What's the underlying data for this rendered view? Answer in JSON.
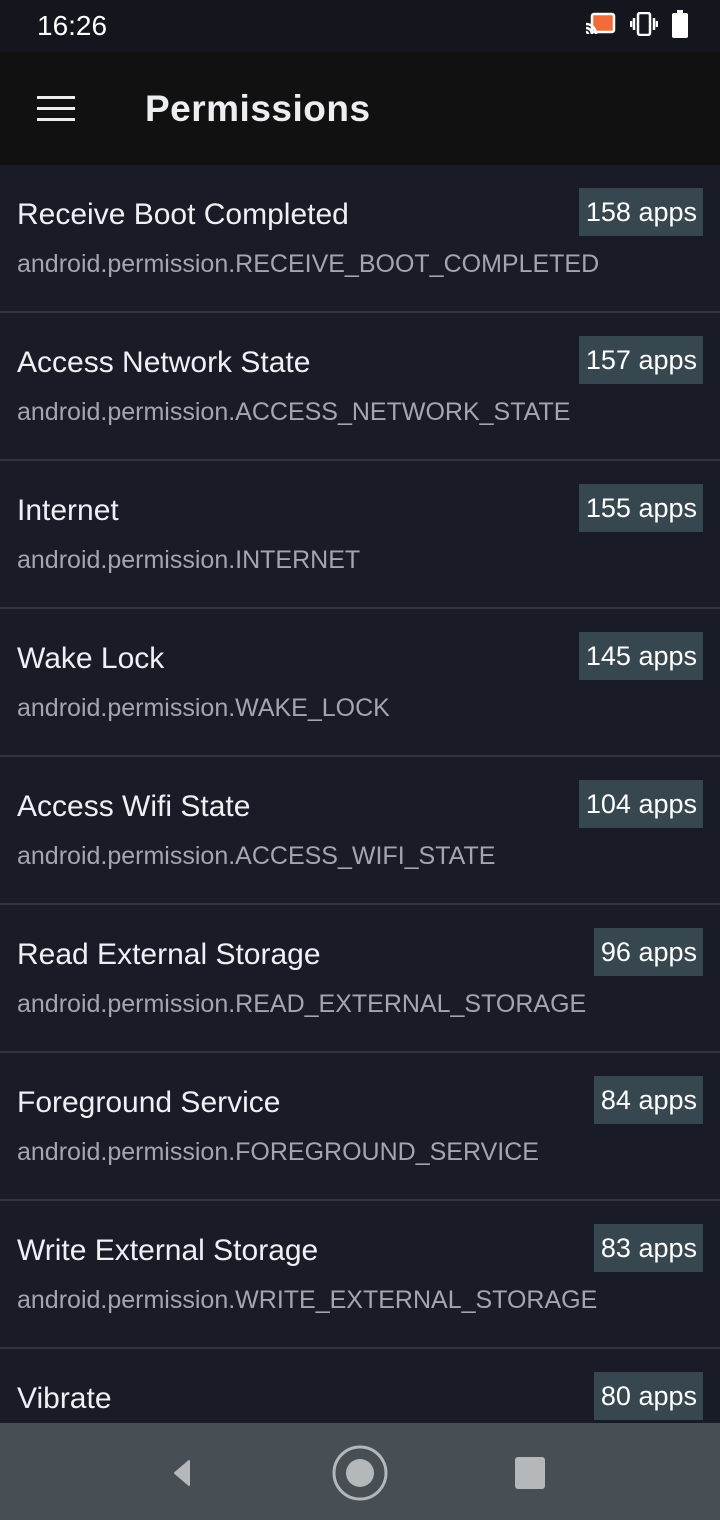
{
  "status_bar": {
    "time": "16:26",
    "icons": [
      "cast-icon",
      "vibrate-icon",
      "battery-icon"
    ],
    "cast_color": "#f26b3a"
  },
  "app_bar": {
    "title": "Permissions",
    "menu_icon": "hamburger-menu-icon"
  },
  "colors": {
    "background": "#191c26",
    "badge": "#37474f",
    "app_bar": "#111111",
    "nav_bar": "#474f55"
  },
  "permissions": [
    {
      "name": "Receive Boot Completed",
      "id": "android.permission.RECEIVE_BOOT_COMPLETED",
      "count": "158 apps"
    },
    {
      "name": "Access Network State",
      "id": "android.permission.ACCESS_NETWORK_STATE",
      "count": "157 apps"
    },
    {
      "name": "Internet",
      "id": "android.permission.INTERNET",
      "count": "155 apps"
    },
    {
      "name": "Wake Lock",
      "id": "android.permission.WAKE_LOCK",
      "count": "145 apps"
    },
    {
      "name": "Access Wifi State",
      "id": "android.permission.ACCESS_WIFI_STATE",
      "count": "104 apps"
    },
    {
      "name": "Read External Storage",
      "id": "android.permission.READ_EXTERNAL_STORAGE",
      "count": "96 apps"
    },
    {
      "name": "Foreground Service",
      "id": "android.permission.FOREGROUND_SERVICE",
      "count": "84 apps"
    },
    {
      "name": "Write External Storage",
      "id": "android.permission.WRITE_EXTERNAL_STORAGE",
      "count": "83 apps"
    },
    {
      "name": "Vibrate",
      "id": "",
      "count": "80 apps"
    }
  ],
  "nav_bar": {
    "buttons": [
      "back-icon",
      "home-icon",
      "recents-icon"
    ]
  }
}
